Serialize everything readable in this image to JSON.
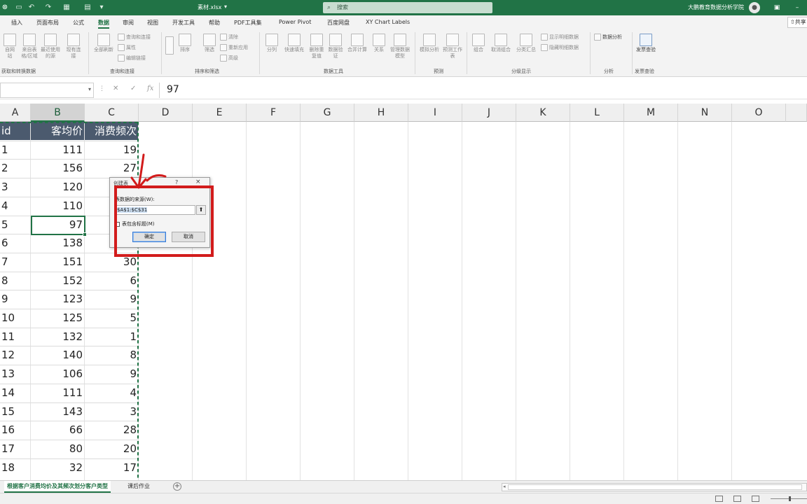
{
  "titlebar": {
    "filename": "素材.xlsx",
    "search_placeholder": "搜索",
    "user": "大鹏教育数据分析学院",
    "quick_access": [
      "保存",
      "撤消",
      "恢复",
      "表格",
      "菜单",
      "更多"
    ]
  },
  "tabs": [
    "插入",
    "页面布局",
    "公式",
    "数据",
    "审阅",
    "视图",
    "开发工具",
    "帮助",
    "PDF工具集",
    "Power Pivot",
    "百度网盘",
    "XY Chart Labels"
  ],
  "active_tab": "数据",
  "share_label": "共享",
  "ribbon": {
    "groups": [
      {
        "label": "获取和转换数据",
        "items": [
          "自网站",
          "来自表格/区域",
          "最近使用的源",
          "现有连接"
        ]
      },
      {
        "label": "查询和连接",
        "items": [
          "全部刷新"
        ],
        "small": [
          "查询和连接",
          "属性",
          "编辑链接"
        ]
      },
      {
        "label": "排序和筛选",
        "items": [
          "排序",
          "筛选"
        ],
        "small": [
          "清除",
          "重新应用",
          "高级"
        ]
      },
      {
        "label": "数据工具",
        "items": [
          "分列",
          "快速填充",
          "删除重复值",
          "数据验证",
          "合并计算",
          "关系",
          "管理数据模型"
        ]
      },
      {
        "label": "预测",
        "items": [
          "模拟分析",
          "预测工作表"
        ]
      },
      {
        "label": "分级显示",
        "items": [
          "组合",
          "取消组合",
          "分类汇总"
        ],
        "small": [
          "显示明细数据",
          "隐藏明细数据"
        ]
      },
      {
        "label": "分析",
        "small": [
          "数据分析"
        ]
      },
      {
        "label": "发票查验",
        "items": [
          "发票查验"
        ]
      }
    ]
  },
  "formula_bar": {
    "name_box": "",
    "value": "97"
  },
  "columns": [
    "A",
    "B",
    "C",
    "D",
    "E",
    "F",
    "G",
    "H",
    "I",
    "J",
    "K",
    "L",
    "M",
    "N",
    "O"
  ],
  "table": {
    "headers": [
      "id",
      "客均价",
      "消费频次"
    ],
    "rows": [
      [
        "1",
        "111",
        "19"
      ],
      [
        "2",
        "156",
        "27"
      ],
      [
        "3",
        "120",
        ""
      ],
      [
        "4",
        "110",
        ""
      ],
      [
        "5",
        "97",
        ""
      ],
      [
        "6",
        "138",
        "17"
      ],
      [
        "7",
        "151",
        "30"
      ],
      [
        "8",
        "152",
        "6"
      ],
      [
        "9",
        "123",
        "9"
      ],
      [
        "10",
        "125",
        "5"
      ],
      [
        "11",
        "132",
        "1"
      ],
      [
        "12",
        "140",
        "8"
      ],
      [
        "13",
        "106",
        "9"
      ],
      [
        "14",
        "111",
        "4"
      ],
      [
        "15",
        "143",
        "3"
      ],
      [
        "16",
        "66",
        "28"
      ],
      [
        "17",
        "80",
        "20"
      ],
      [
        "18",
        "32",
        "17"
      ]
    ]
  },
  "dialog": {
    "title": "创建表",
    "help": "?",
    "close": "×",
    "source_label": "表数据的来源(W):",
    "range": "$A$1:$C$31",
    "has_headers_label": "表包含标题(M)",
    "ok": "确定",
    "cancel": "取消"
  },
  "sheets": [
    "根据客户消费均价及其频次划分客户类型",
    "课后作业"
  ],
  "active_sheet": "根据客户消费均价及其频次划分客户类型",
  "colors": {
    "accent": "#217346",
    "header_fill": "#4b5a6e",
    "annotation": "#d21c1c"
  }
}
